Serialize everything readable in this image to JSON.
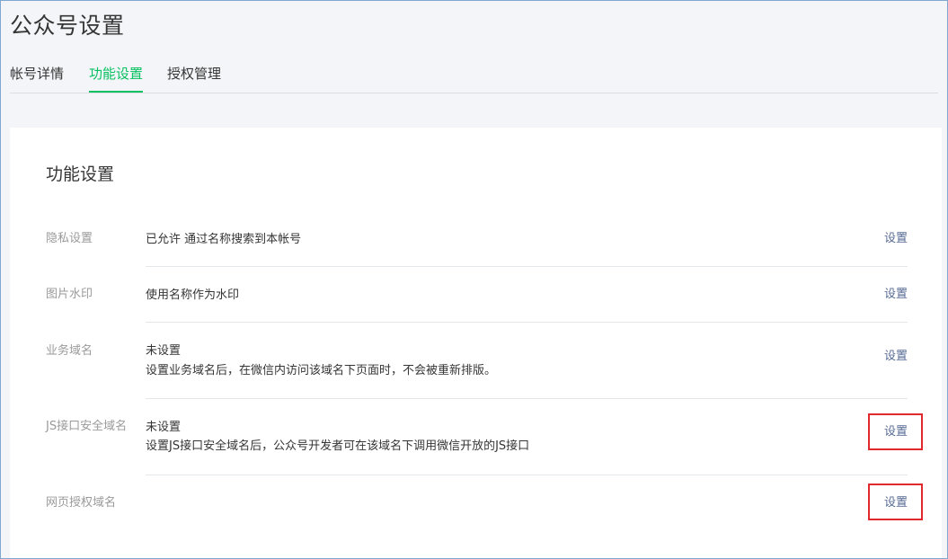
{
  "page": {
    "title": "公众号设置"
  },
  "tabs": [
    {
      "label": "帐号详情",
      "active": false
    },
    {
      "label": "功能设置",
      "active": true
    },
    {
      "label": "授权管理",
      "active": false
    }
  ],
  "section": {
    "title": "功能设置",
    "rows": [
      {
        "label": "隐私设置",
        "value": "已允许 通过名称搜索到本帐号",
        "description": "",
        "action": "设置"
      },
      {
        "label": "图片水印",
        "value": "使用名称作为水印",
        "description": "",
        "action": "设置"
      },
      {
        "label": "业务域名",
        "value": "未设置",
        "description": "设置业务域名后，在微信内访问该域名下页面时，不会被重新排版。",
        "action": "设置"
      },
      {
        "label": "JS接口安全域名",
        "value": "未设置",
        "description": "设置JS接口安全域名后，公众号开发者可在该域名下调用微信开放的JS接口",
        "action": "设置"
      },
      {
        "label": "网页授权域名",
        "value": "",
        "description": "",
        "action": "设置"
      }
    ]
  },
  "colors": {
    "accent": "#07c160",
    "link": "#576b95",
    "highlight": "#e0282d"
  }
}
